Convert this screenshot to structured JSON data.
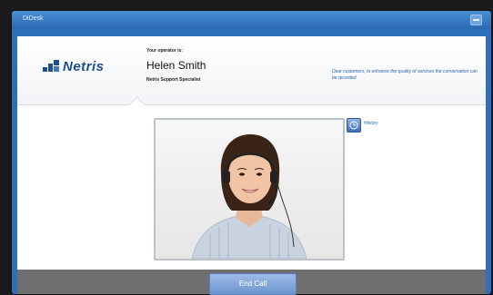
{
  "window": {
    "title": "DiDesk"
  },
  "brand": {
    "logo_text": "Netris"
  },
  "operator": {
    "caption": "Your operator is:",
    "name": "Helen Smith",
    "role": "Netris Support Specialist"
  },
  "notice": "Dear customers, to enhance the quality of services the conversation can be recorded",
  "history": {
    "label": "History"
  },
  "footer": {
    "end_call_label": "End Call"
  },
  "colors": {
    "window_blue": "#2d6fb8",
    "accent_blue": "#2a62b4",
    "footer_gray": "#6f6f71"
  }
}
